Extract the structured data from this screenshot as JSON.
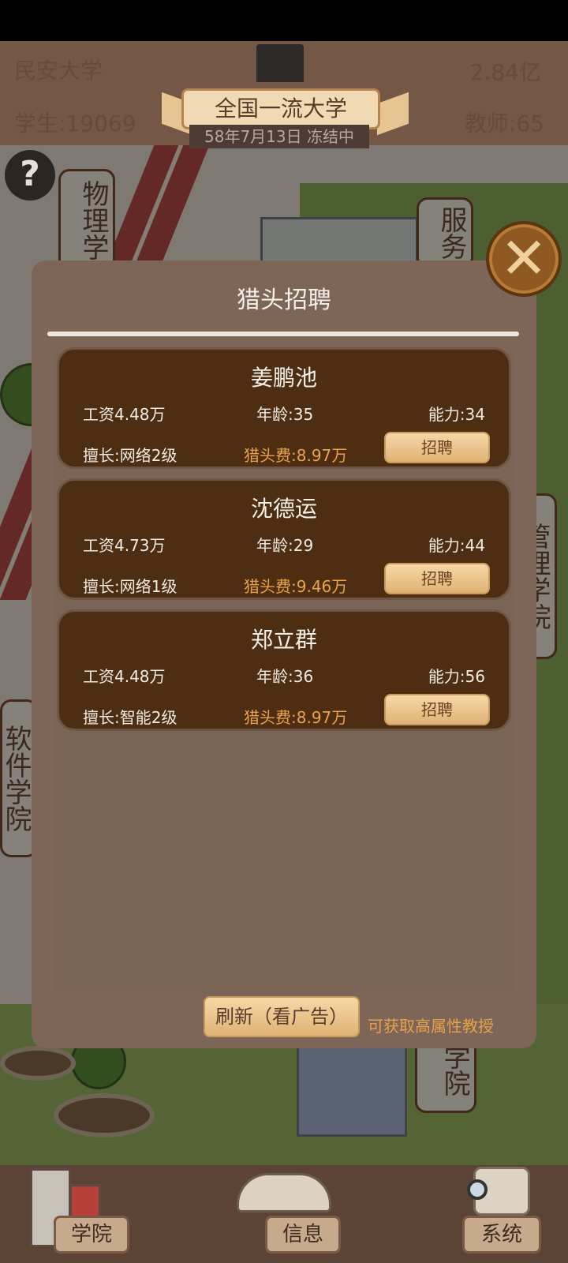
{
  "hud": {
    "university_name": "民安大学",
    "money": "2.84亿",
    "students": "学生:19069",
    "teachers": "教师:65",
    "rank_title": "全国一流大学",
    "date_status": "58年7月13日 冻结中",
    "help_icon": "question-mark"
  },
  "map": {
    "signs": {
      "physics": "物理学",
      "service": "服务",
      "software": "软件学院",
      "management": "管理学院",
      "bottom": "学院"
    }
  },
  "dialog": {
    "title": "猎头招聘",
    "close_icon": "close-x",
    "candidates": [
      {
        "name": "姜鹏池",
        "salary": "工资4.48万",
        "age": "年龄:35",
        "ability": "能力:34",
        "skill": "擅长:网络2级",
        "fee": "猎头费:8.97万",
        "hire_label": "招聘"
      },
      {
        "name": "沈德运",
        "salary": "工资4.73万",
        "age": "年龄:29",
        "ability": "能力:44",
        "skill": "擅长:网络1级",
        "fee": "猎头费:9.46万",
        "hire_label": "招聘"
      },
      {
        "name": "郑立群",
        "salary": "工资4.48万",
        "age": "年龄:36",
        "ability": "能力:56",
        "skill": "擅长:智能2级",
        "fee": "猎头费:8.97万",
        "hire_label": "招聘"
      }
    ],
    "refresh_label": "刷新（看广告）",
    "refresh_hint": "可获取高属性教授"
  },
  "nav": {
    "college": "学院",
    "info": "信息",
    "system": "系统"
  },
  "colors": {
    "dialog_bg": "#7d6657",
    "card_bg": "#4e2e12",
    "fee_text": "#e9a34b",
    "button_bg": "#f6d8a6"
  }
}
